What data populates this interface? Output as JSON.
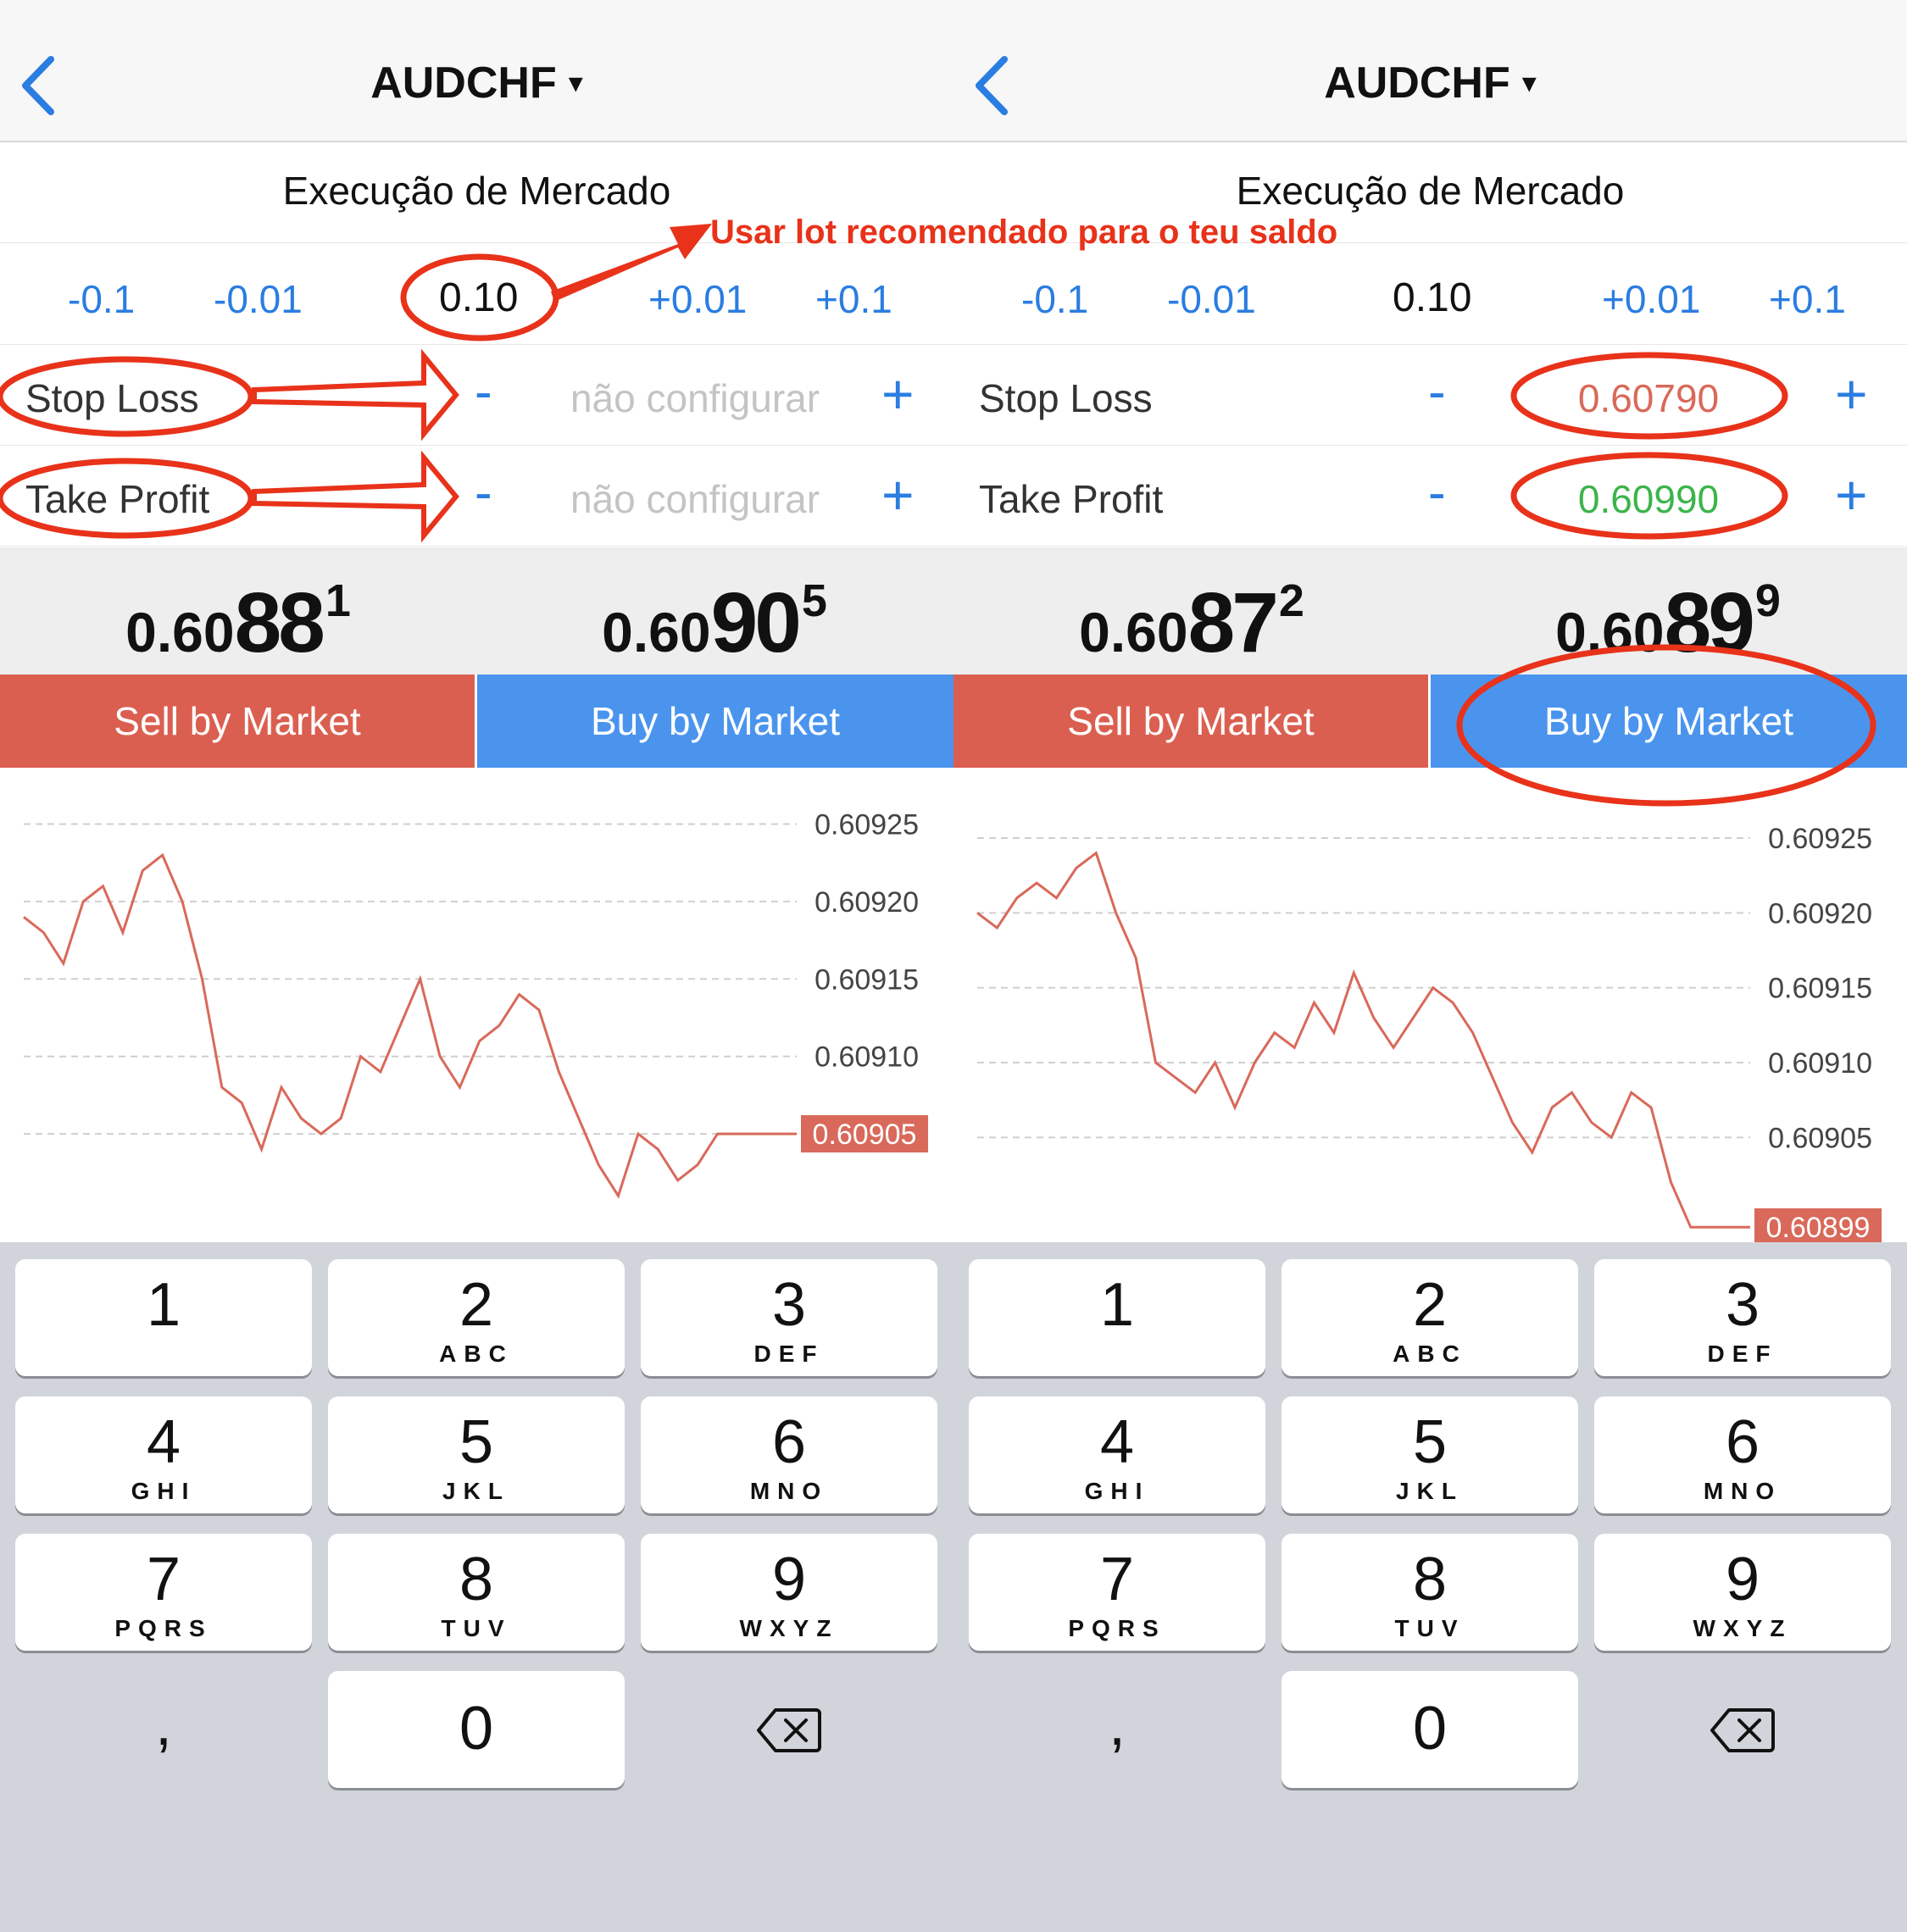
{
  "colors": {
    "accent_blue": "#2a7de1",
    "sell_red": "#db5f50",
    "buy_blue": "#4a94ee",
    "line_red": "#d9695a",
    "annotation_red": "#e8321a",
    "sl_value": "#d9695a",
    "tp_value": "#3cb44b"
  },
  "annotation_note": "Usar lot recomendado para o teu saldo",
  "left": {
    "nav": {
      "back_icon": "chevron-left-icon",
      "title": "AUDCHF",
      "caret": "▾"
    },
    "execution_title": "Execução de Mercado",
    "lot": {
      "minus_01": "-0.1",
      "minus_001": "-0.01",
      "value": "0.10",
      "plus_001": "+0.01",
      "plus_01": "+0.1"
    },
    "stop_loss": {
      "label": "Stop Loss",
      "minus": "-",
      "value": "não configurar",
      "plus": "+"
    },
    "take_profit": {
      "label": "Take Profit",
      "minus": "-",
      "value": "não configurar",
      "plus": "+"
    },
    "bid": {
      "small": "0.60",
      "big": "88",
      "sup": "1"
    },
    "ask": {
      "small": "0.60",
      "big": "90",
      "sup": "5"
    },
    "sell_label": "Sell by Market",
    "buy_label": "Buy by Market"
  },
  "right": {
    "nav": {
      "back_icon": "chevron-left-icon",
      "title": "AUDCHF",
      "caret": "▾"
    },
    "execution_title": "Execução de Mercado",
    "lot": {
      "minus_01": "-0.1",
      "minus_001": "-0.01",
      "value": "0.10",
      "plus_001": "+0.01",
      "plus_01": "+0.1"
    },
    "stop_loss": {
      "label": "Stop Loss",
      "minus": "-",
      "value": "0.60790",
      "plus": "+"
    },
    "take_profit": {
      "label": "Take Profit",
      "minus": "-",
      "value": "0.60990",
      "plus": "+"
    },
    "bid": {
      "small": "0.60",
      "big": "87",
      "sup": "2"
    },
    "ask": {
      "small": "0.60",
      "big": "89",
      "sup": "9"
    },
    "sell_label": "Sell by Market",
    "buy_label": "Buy by Market"
  },
  "chart_data": [
    {
      "type": "line",
      "title": "",
      "ylim": [
        0.60898,
        0.60927
      ],
      "yticks": [
        "0.60925",
        "0.60920",
        "0.60915",
        "0.60910",
        "0.60905"
      ],
      "current_price": "0.60905",
      "grid": true,
      "series": [
        {
          "values": [
            0.60919,
            0.60918,
            0.60916,
            0.6092,
            0.60921,
            0.60918,
            0.60922,
            0.60923,
            0.6092,
            0.60915,
            0.60908,
            0.60907,
            0.60904,
            0.60908,
            0.60906,
            0.60905,
            0.60906,
            0.6091,
            0.60909,
            0.60912,
            0.60915,
            0.6091,
            0.60908,
            0.60911,
            0.60912,
            0.60914,
            0.60913,
            0.60909,
            0.60906,
            0.60903,
            0.60901,
            0.60905,
            0.60904,
            0.60902,
            0.60903,
            0.60905,
            0.60905,
            0.60905,
            0.60905,
            0.60905
          ]
        }
      ]
    },
    {
      "type": "line",
      "title": "",
      "ylim": [
        0.60898,
        0.60928
      ],
      "yticks": [
        "0.60925",
        "0.60920",
        "0.60915",
        "0.60910",
        "0.60905"
      ],
      "current_price": "0.60899",
      "grid": true,
      "series": [
        {
          "values": [
            0.6092,
            0.60919,
            0.60921,
            0.60922,
            0.60921,
            0.60923,
            0.60924,
            0.6092,
            0.60917,
            0.6091,
            0.60909,
            0.60908,
            0.6091,
            0.60907,
            0.6091,
            0.60912,
            0.60911,
            0.60914,
            0.60912,
            0.60916,
            0.60913,
            0.60911,
            0.60913,
            0.60915,
            0.60914,
            0.60912,
            0.60909,
            0.60906,
            0.60904,
            0.60907,
            0.60908,
            0.60906,
            0.60905,
            0.60908,
            0.60907,
            0.60902,
            0.60899,
            0.60899,
            0.60899,
            0.60899
          ]
        }
      ]
    }
  ],
  "keyboard": {
    "keys": [
      {
        "n": "1",
        "l": ""
      },
      {
        "n": "2",
        "l": "ABC"
      },
      {
        "n": "3",
        "l": "DEF"
      },
      {
        "n": "4",
        "l": "GHI"
      },
      {
        "n": "5",
        "l": "JKL"
      },
      {
        "n": "6",
        "l": "MNO"
      },
      {
        "n": "7",
        "l": "PQRS"
      },
      {
        "n": "8",
        "l": "TUV"
      },
      {
        "n": "9",
        "l": "WXYZ"
      }
    ],
    "comma": ",",
    "zero": "0",
    "delete_icon": "backspace-icon"
  }
}
